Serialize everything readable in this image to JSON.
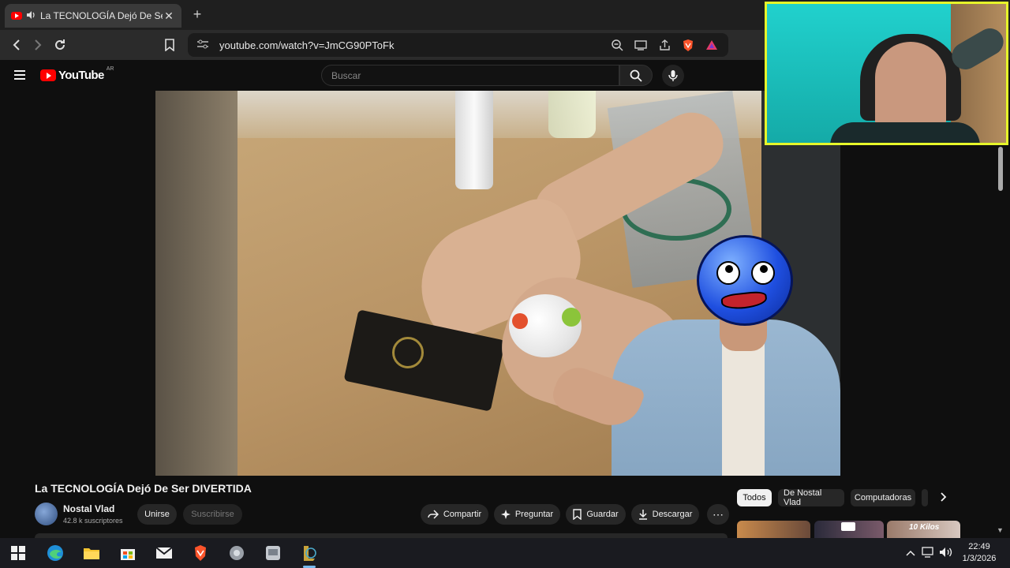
{
  "browser": {
    "tab_title": "La TECNOLOGÍA Dejó De Ser DIVERTIDA",
    "tab_close": "✕",
    "new_tab": "+",
    "url": "youtube.com/watch?v=JmCG90PToFk"
  },
  "icons": {
    "back": "chevron-left-icon",
    "forward": "chevron-right-icon",
    "reload": "reload-icon",
    "bookmark": "bookmark-icon",
    "site_settings": "tune-icon",
    "zoom": "zoom-icon",
    "cast": "cast-icon",
    "share": "share-icon",
    "brave_shield": "brave-shield-icon",
    "brave_rewards": "brave-rewards-icon"
  },
  "youtube": {
    "logo_text": "YouTube",
    "country_code": "AR",
    "search_placeholder": "Buscar"
  },
  "video": {
    "title": "La TECNOLOGÍA Dejó De Ser DIVERTIDA",
    "channel_name": "Nostal Vlad",
    "subscribers": "42.8 k suscriptores",
    "join_label": "Unirse",
    "subscribe_label": "Suscribirse",
    "actions": [
      {
        "label": "Compartir",
        "icon": "share-icon"
      },
      {
        "label": "Preguntar",
        "icon": "sparkle-icon"
      },
      {
        "label": "Guardar",
        "icon": "bookmark-icon"
      },
      {
        "label": "Descargar",
        "icon": "download-icon"
      }
    ],
    "more": "⋯"
  },
  "chips": [
    "Todos",
    "De Nostal Vlad",
    "Computadoras"
  ],
  "related": {
    "thumb_badge": "10 Kilos"
  },
  "taskbar": {
    "time": "22:49",
    "date": "1/3/2026",
    "apps": [
      "windows-start-icon",
      "edge-icon",
      "file-explorer-icon",
      "store-icon",
      "mail-icon",
      "brave-icon",
      "app-icon",
      "app2-icon",
      "league-of-legends-icon"
    ]
  },
  "colors": {
    "youtube_red": "#ff0000",
    "webcam_border": "#e6f62a",
    "accent_blue": "#76b9ed"
  }
}
